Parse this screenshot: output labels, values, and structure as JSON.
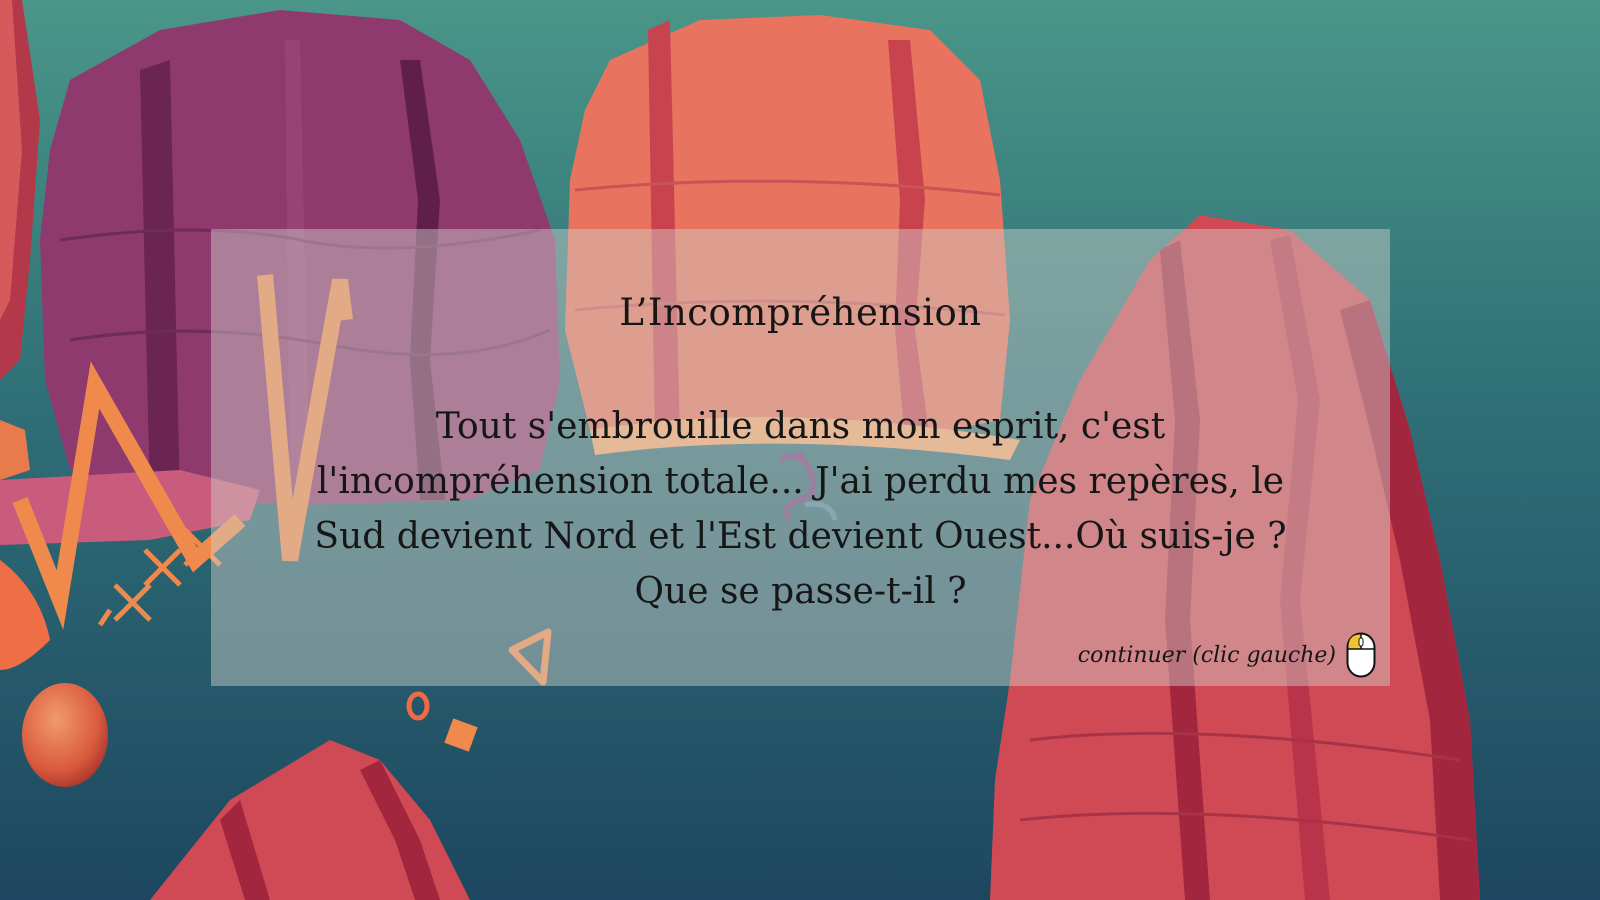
{
  "dialog": {
    "title": "L’Incompréhension",
    "body": "Tout s'embrouille dans mon esprit, c'est l'incompréhension totale... J'ai perdu mes repères, le Sud devient Nord et l'Est devient Ouest...Où suis-je ? Que se passe-t-il ?",
    "continue_label": "continuer (clic gauche)",
    "continue_icon": "mouse-left-click-icon"
  },
  "colors": {
    "sky_top": "#4a9688",
    "sky_bottom": "#1f4c62",
    "rock_purple": "#8e3a6e",
    "rock_coral": "#e8735e",
    "rock_red": "#cf4a55",
    "rock_dark": "#a3263f",
    "zigzag_orange": "#ef8a4c",
    "dialog_panel": "rgba(210,210,205,0.45)",
    "text": "#161616",
    "mouse_highlight": "#f2c230"
  }
}
